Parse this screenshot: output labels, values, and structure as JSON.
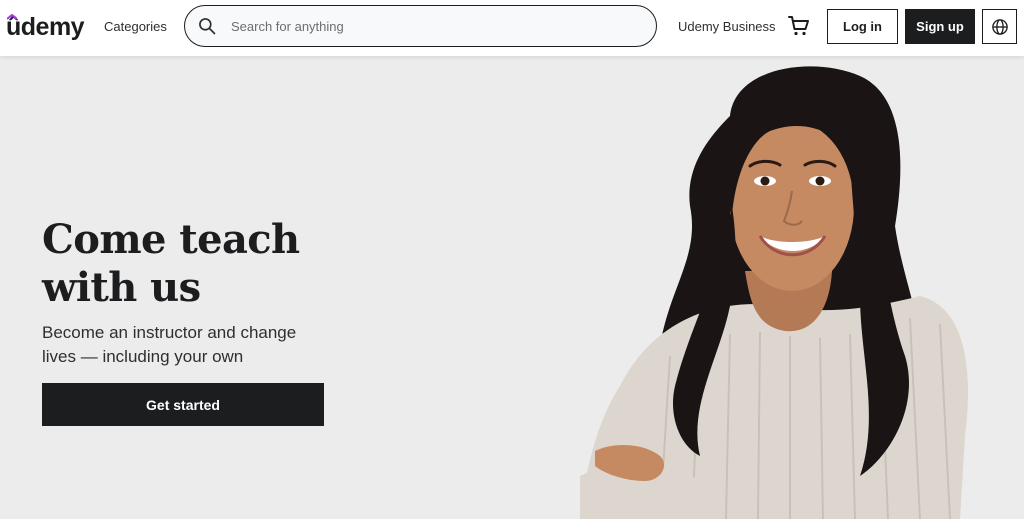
{
  "header": {
    "logo_text": "ûdemy",
    "categories_label": "Categories",
    "search_placeholder": "Search for anything",
    "business_label": "Udemy Business",
    "login_label": "Log in",
    "signup_label": "Sign up"
  },
  "hero": {
    "title": "Come teach with us",
    "subtitle": "Become an instructor and change lives — including your own",
    "cta_label": "Get started"
  },
  "icons": {
    "search": "search-icon",
    "cart": "cart-icon",
    "language": "globe-icon"
  },
  "colors": {
    "brand_dark": "#1c1d1f",
    "brand_accent": "#a435f0",
    "hero_bg": "#ececec"
  }
}
